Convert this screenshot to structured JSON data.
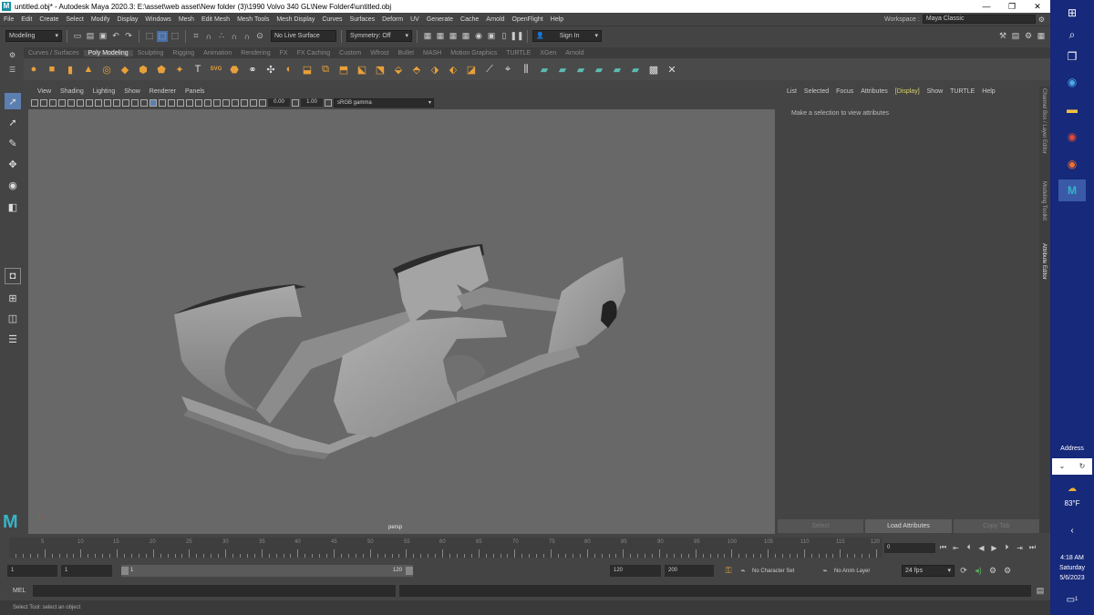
{
  "window": {
    "title": "untitled.obj* - Autodesk Maya 2020.3: E:\\asset\\web asset\\New folder (3)\\1990 Volvo 340 GL\\New Folder4\\untitled.obj",
    "logo": "M"
  },
  "menus": [
    "File",
    "Edit",
    "Create",
    "Select",
    "Modify",
    "Display",
    "Windows",
    "Mesh",
    "Edit Mesh",
    "Mesh Tools",
    "Mesh Display",
    "Curves",
    "Surfaces",
    "Deform",
    "UV",
    "Generate",
    "Cache",
    "Arnold",
    "OpenFlight",
    "Help"
  ],
  "workspace": {
    "label": "Workspace :",
    "value": "Maya Classic"
  },
  "status_line": {
    "mode": "Modeling",
    "live_surface": "No Live Surface",
    "symmetry": "Symmetry: Off",
    "sign_in": "Sign In"
  },
  "shelf_tabs": [
    "Curves / Surfaces",
    "Poly Modeling",
    "Sculpting",
    "Rigging",
    "Animation",
    "Rendering",
    "FX",
    "FX Caching",
    "Custom",
    "Wfrost",
    "Bullet",
    "MASH",
    "Motion Graphics",
    "TURTLE",
    "XGen",
    "Arnold"
  ],
  "active_shelf_tab": "Poly Modeling",
  "shelf_text_icon": "T",
  "shelf_svg_icon": "SVG",
  "viewport": {
    "menus": [
      "View",
      "Shading",
      "Lighting",
      "Show",
      "Renderer",
      "Panels"
    ],
    "exposure": "0.00",
    "gamma": "1.00",
    "color_space": "sRGB gamma",
    "camera": "persp"
  },
  "attribute_editor": {
    "menus": [
      "List",
      "Selected",
      "Focus",
      "Attributes",
      "[Display]",
      "Show",
      "TURTLE",
      "Help"
    ],
    "message": "Make a selection to view attributes",
    "buttons": [
      "Select",
      "Load Attributes",
      "Copy Tab"
    ],
    "side_tabs": [
      "Channel Box / Layer Editor",
      "Modeling Toolkit",
      "Attribute Editor"
    ]
  },
  "time_slider": {
    "ticks": [
      "5",
      "10",
      "15",
      "20",
      "25",
      "30",
      "35",
      "40",
      "45",
      "50",
      "55",
      "60",
      "65",
      "70",
      "75",
      "80",
      "85",
      "90",
      "95",
      "100",
      "105",
      "110",
      "115",
      "120"
    ],
    "current_frame": "0"
  },
  "range_slider": {
    "start": "1",
    "playback_start": "1",
    "range_start": "1",
    "range_end": "120",
    "playback_end": "120",
    "end": "200",
    "character_set": "No Character Set",
    "anim_layer": "No Anim Layer",
    "fps": "24 fps"
  },
  "command_line": {
    "label": "MEL"
  },
  "help_line": "Select Tool: select an object",
  "taskbar": {
    "address_label": "Address",
    "weather": "83°F",
    "time": "4:18 AM",
    "day": "Saturday",
    "date": "5/6/2023",
    "notification_count": "1"
  },
  "colors": {
    "viewport_bg": "#686868",
    "ui_bg": "#444444",
    "accent": "#5b7fb0",
    "taskbar": "#16297a"
  }
}
